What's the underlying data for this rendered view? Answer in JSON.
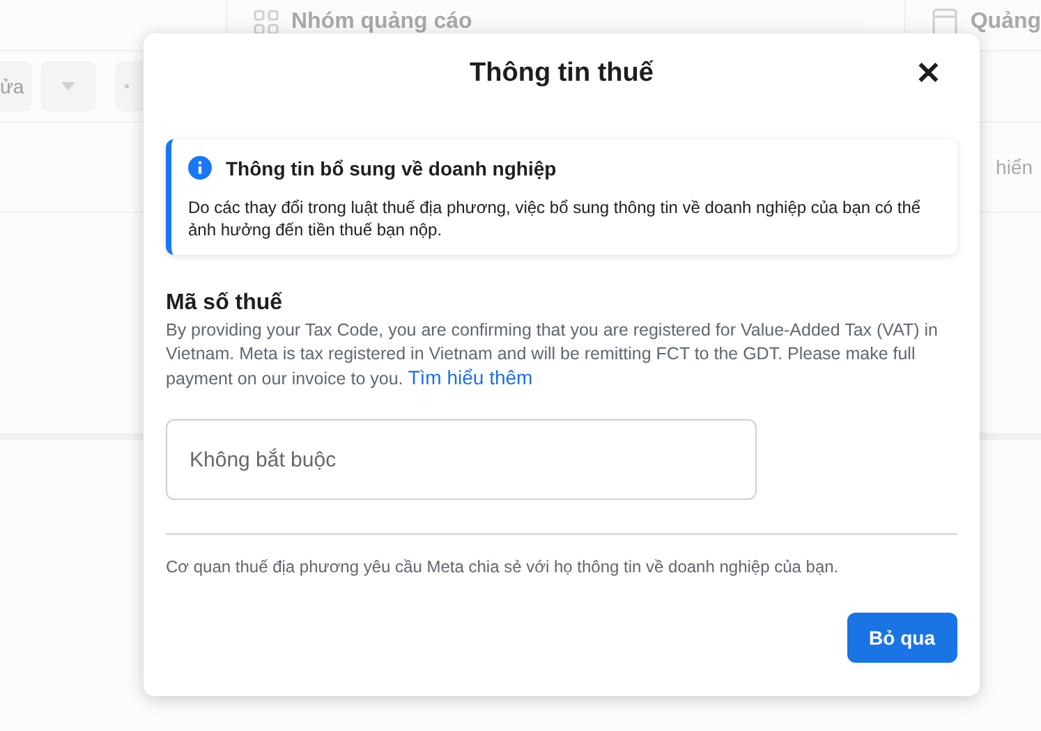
{
  "background": {
    "tabs": [
      {
        "label": "Nhóm quảng cáo",
        "kind": "grid"
      },
      {
        "label": "Quảng",
        "kind": "page"
      }
    ],
    "toolbar_button": "ửa",
    "side_text": "hiển"
  },
  "dialog": {
    "title": "Thông tin thuế",
    "close": "✕",
    "notice": {
      "title": "Thông tin bổ sung về doanh nghiệp",
      "body": "Do các thay đổi trong luật thuế địa phương, việc bổ sung thông tin về doanh nghiệp của bạn có thể ảnh hưởng đến tiền thuế bạn nộp."
    },
    "section_title": "Mã số thuế",
    "description": "By providing your Tax Code, you are confirming that you are registered for Value-Added Tax (VAT) in Vietnam. Meta is tax registered in Vietnam and will be remitting FCT to the GDT. Please make full payment on our invoice to you.",
    "link": "Tìm hiểu thêm",
    "field": {
      "placeholder": "Không bắt buộc"
    },
    "footnote": "Cơ quan thuế địa phương yêu cầu Meta chia sẻ với họ thông tin về doanh nghiệp của bạn.",
    "buttons": [
      "Bỏ qua"
    ]
  }
}
